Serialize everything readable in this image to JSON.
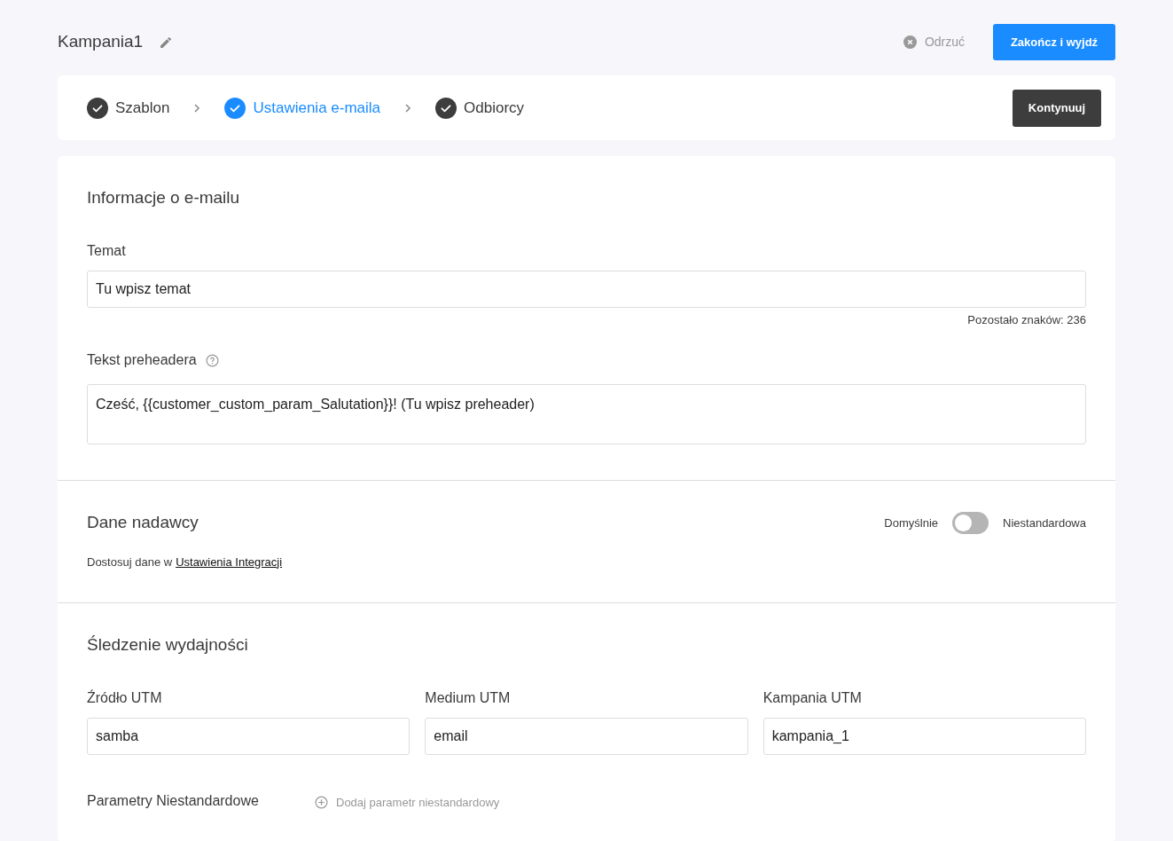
{
  "campaign": {
    "title": "Kampania1"
  },
  "actions": {
    "discard": "Odrzuć",
    "finish": "Zakończ i wyjdź"
  },
  "steps": [
    {
      "label": "Szablon",
      "done": true,
      "selected": false
    },
    {
      "label": "Ustawienia e-maila",
      "done": true,
      "selected": true
    },
    {
      "label": "Odbiorcy",
      "done": true,
      "selected": false
    }
  ],
  "continue_button": "Kontynuuj",
  "email_info": {
    "heading": "Informacje o e-mailu",
    "subject_label": "Temat",
    "subject_value": "Tu wpisz temat",
    "chars_left": "Pozostało znaków: 236",
    "preheader_label": "Tekst preheadera",
    "preheader_value": "Cześć, {{customer_custom_param_Salutation}}! (Tu wpisz preheader)"
  },
  "sender": {
    "heading": "Dane nadawcy",
    "toggle_left": "Domyślnie",
    "toggle_right": "Niestandardowa",
    "custom": false,
    "hint": "Dostosuj dane w",
    "hint_link": "Ustawienia Integracji"
  },
  "tracking": {
    "heading": "Śledzenie wydajności",
    "fields": [
      {
        "label": "Źródło UTM",
        "value": "samba"
      },
      {
        "label": "Medium UTM",
        "value": "email"
      },
      {
        "label": "Kampania UTM",
        "value": "kampania_1"
      }
    ],
    "custom_params_label": "Parametry Niestandardowe",
    "add_param": "Dodaj parametr niestandardowy"
  }
}
